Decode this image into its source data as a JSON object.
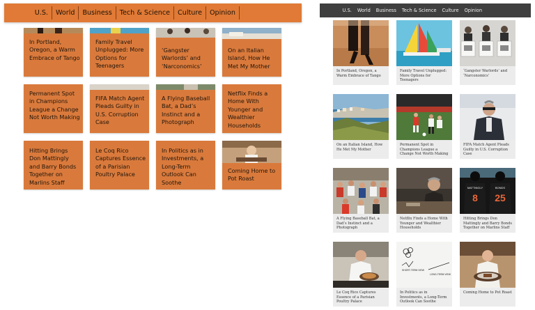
{
  "nav": {
    "items": [
      "U.S.",
      "World",
      "Business",
      "Tech & Science",
      "Culture",
      "Opinion"
    ]
  },
  "left": {
    "tiles": [
      {
        "title": "In Portland, Oregon, a Warm Embrace of Tango"
      },
      {
        "title": "Family Travel Unplugged: More Options for Teenagers"
      },
      {
        "title": "‘Gangster Warlords’ and ‘Narconomics’"
      },
      {
        "title": "On an Italian Island, How He Met My Mother"
      },
      {
        "title": "Permanent Spot in Champions League a Change Not Worth Making"
      },
      {
        "title": "FIFA Match Agent Pleads Guilty in U.S. Corruption Case"
      },
      {
        "title": "A Flying Baseball Bat, a Dad’s Instinct and a Photograph"
      },
      {
        "title": "Netflix Finds a Home With Younger and Wealthier Households"
      },
      {
        "title": "Hitting Brings Don Mattingly and Barry Bonds Together on Marlins Staff"
      },
      {
        "title": "Le Coq Rico Captures Essence of a Parisian Poultry Palace"
      },
      {
        "title": "In Politics as in Investments, a Long-Term Outlook Can Soothe"
      },
      {
        "title": "Coming Home to Pot Roast"
      }
    ]
  },
  "right": {
    "tiles": [
      {
        "title": "In Portland, Oregon, a Warm Embrace of Tango"
      },
      {
        "title": "Family Travel Unplugged: More Options for Teenagers"
      },
      {
        "title": "‘Gangster Warlords’ and ‘Narconomics’"
      },
      {
        "title": "On an Italian Island, How He Met My Mother"
      },
      {
        "title": "Permanent Spot in Champions League a Change Not Worth Making"
      },
      {
        "title": "FIFA Match Agent Pleads Guilty in U.S. Corruption Case"
      },
      {
        "title": "A Flying Baseball Bat, a Dad’s Instinct and a Photograph"
      },
      {
        "title": "Netflix Finds a Home With Younger and Wealthier Households"
      },
      {
        "title": "Hitting Brings Don Mattingly and Barry Bonds Together on Marlins Staff"
      },
      {
        "title": "Le Coq Rico Captures Essence of a Parisian Poultry Palace"
      },
      {
        "title": "In Politics as in Investments, a Long-Term Outlook Can Soothe"
      },
      {
        "title": "Coming Home to Pot Roast"
      }
    ],
    "jersey_text": [
      "MATTINGLY",
      "8",
      "BONDS",
      "25"
    ],
    "sketch_text": [
      "SHORT-TERM VIEW",
      "LONG-TERM VIEW"
    ]
  },
  "colors": {
    "accent_orange": "#e07a36",
    "tile_orange": "#d97a3c",
    "dark_nav": "#3f3f3f",
    "caption_bg": "#ececec"
  }
}
